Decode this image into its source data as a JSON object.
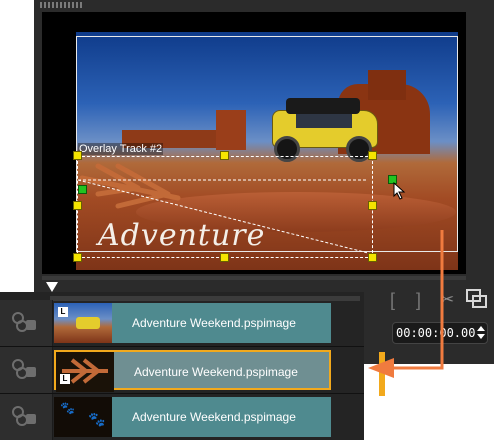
{
  "preview": {
    "overlay_track_label": "Overlay Track #2",
    "overlay_text": "Adventure"
  },
  "controls": {
    "mark_in_label": "[",
    "mark_out_label": "]",
    "cut_icon": "scissors-icon",
    "copy_icon": "copy-icon",
    "timecode": "00:00:00.00"
  },
  "timeline": {
    "tracks": [
      {
        "icon": "video-track-icon",
        "clip_label": "Adventure Weekend.pspimage",
        "thumb_badge": "L",
        "selected": false
      },
      {
        "icon": "overlay-track-icon",
        "clip_label": "Adventure Weekend.pspimage",
        "thumb_badge": "L",
        "selected": true
      },
      {
        "icon": "overlay-track-icon",
        "clip_label": "Adventure Weekend.pspimage",
        "thumb_badge": "",
        "selected": false
      }
    ]
  },
  "colors": {
    "accent": "#f2a91c",
    "clip": "#4f8a8f",
    "annotation_arrow": "#f07b3f",
    "handle_yellow": "#f4e400",
    "handle_green": "#21c321"
  }
}
